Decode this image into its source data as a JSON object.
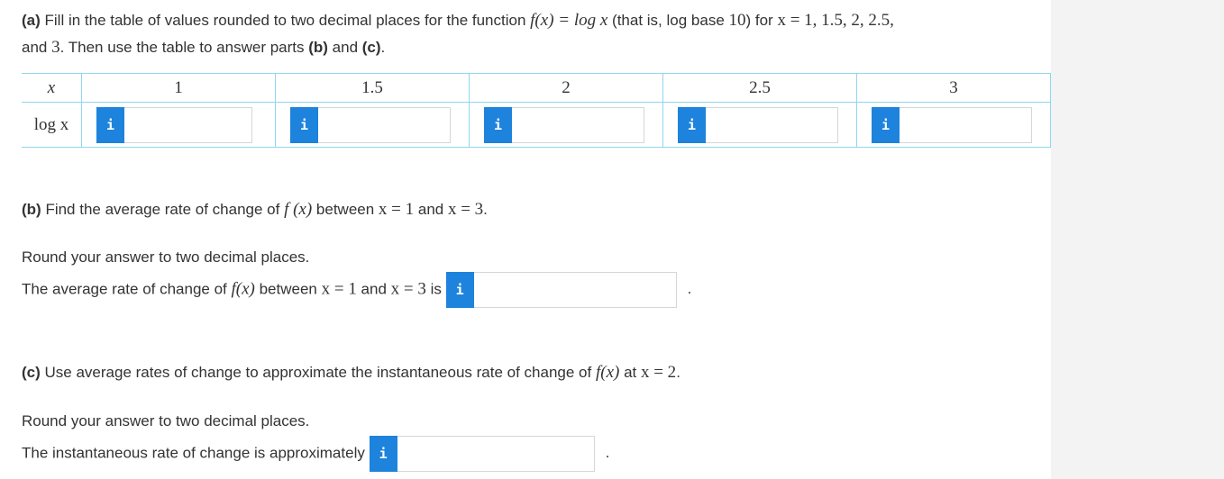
{
  "part_a": {
    "label": "(a)",
    "text_1": " Fill in the table of values rounded to two decimal places for the function ",
    "func": "f(x) = log x",
    "text_2": " (that is, log base ",
    "base": "10",
    "text_3": ") for ",
    "xlist": "x = 1, 1.5, 2, 2.5,",
    "text_4": "and ",
    "last": "3",
    "text_5": ". Then use the table to answer parts ",
    "b_ref": "(b)",
    "text_6": " and ",
    "c_ref": "(c)",
    "text_7": "."
  },
  "table": {
    "x_header": "x",
    "log_header": "log x",
    "x_values": [
      "1",
      "1.5",
      "2",
      "2.5",
      "3"
    ],
    "info_glyph": "i",
    "answers": [
      "",
      "",
      "",
      "",
      ""
    ]
  },
  "part_b": {
    "label": "(b)",
    "text_1": " Find the average rate of change of ",
    "func": "f (x)",
    "text_2": " between ",
    "x1": "x = 1",
    "text_3": " and ",
    "x2": "x = 3",
    "text_4": ".",
    "round_note": "Round your answer to two decimal places.",
    "ans_text_1": "The average rate of change of ",
    "ans_func": "f(x)",
    "ans_text_2": " between ",
    "ans_x1": "x = 1",
    "ans_text_3": " and ",
    "ans_x2": "x = 3",
    "ans_text_4": " is ",
    "info_glyph": "i",
    "answer": "",
    "period": "."
  },
  "part_c": {
    "label": "(c)",
    "text_1": " Use average rates of change to approximate the instantaneous rate of change of ",
    "func": "f(x)",
    "text_2": " at ",
    "xval": "x = 2",
    "text_3": ".",
    "round_note": "Round your answer to two decimal places.",
    "ans_text": "The instantaneous rate of change is approximately ",
    "info_glyph": "i",
    "answer": "",
    "period": "."
  },
  "colors": {
    "info_button": "#1d83dc",
    "table_border": "#8fd6f0",
    "side_panel": "#f3f3f3"
  }
}
